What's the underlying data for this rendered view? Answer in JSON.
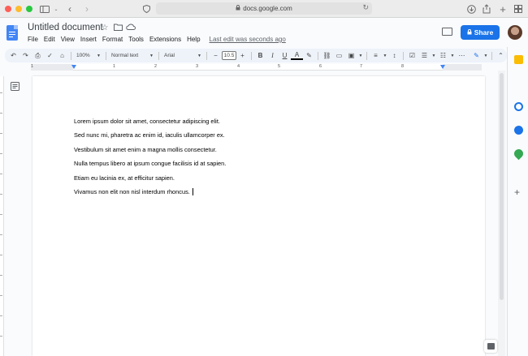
{
  "browser": {
    "url": "docs.google.com"
  },
  "header": {
    "title": "Untitled document",
    "share_label": "Share",
    "menu": [
      "File",
      "Edit",
      "View",
      "Insert",
      "Format",
      "Tools",
      "Extensions",
      "Help"
    ],
    "last_edit": "Last edit was seconds ago"
  },
  "toolbar": {
    "zoom": "100%",
    "style": "Normal text",
    "font": "Arial",
    "font_size": "10.5",
    "bold": "B",
    "italic": "I",
    "underline": "U",
    "text_color_glyph": "A"
  },
  "ruler": {
    "numbers": [
      "1",
      "1",
      "2",
      "3",
      "4",
      "5",
      "6",
      "7",
      "8"
    ]
  },
  "document": {
    "paragraphs": [
      "Lorem ipsum dolor sit amet, consectetur adipiscing elit.",
      "Sed nunc mi, pharetra ac enim id, iaculis ullamcorper ex.",
      "Vestibulum sit amet enim a magna mollis consectetur.",
      "Nulla tempus libero at ipsum congue facilisis id at sapien.",
      "Etiam eu lacinia ex, at efficitur sapien.",
      "Vivamus non elit non nisl interdum rhoncus."
    ]
  },
  "colors": {
    "share_button": "#1a73e8",
    "docs_blue": "#4285f4",
    "toolbar_bg": "#eef2f9"
  }
}
